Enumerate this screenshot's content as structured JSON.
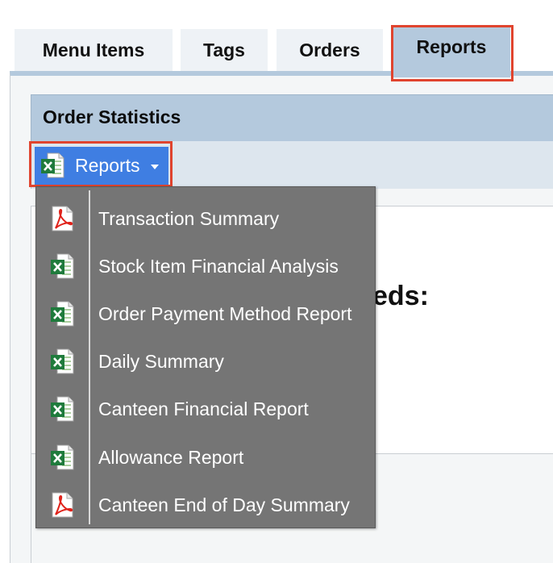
{
  "tabs": [
    {
      "label": "Menu Items"
    },
    {
      "label": "Tags"
    },
    {
      "label": "Orders"
    },
    {
      "label": "Reports",
      "active": true
    }
  ],
  "panel": {
    "title": "Order Statistics",
    "partial_text": "eds:"
  },
  "reports_button": {
    "label": "Reports",
    "icon": "excel-icon"
  },
  "reports_menu": {
    "items": [
      {
        "label": "Transaction Summary",
        "icon": "pdf-icon"
      },
      {
        "label": "Stock Item Financial Analysis",
        "icon": "excel-icon"
      },
      {
        "label": "Order Payment Method Report",
        "icon": "excel-icon"
      },
      {
        "label": "Daily Summary",
        "icon": "excel-icon"
      },
      {
        "label": "Canteen Financial Report",
        "icon": "excel-icon"
      },
      {
        "label": "Allowance Report",
        "icon": "excel-icon"
      },
      {
        "label": "Canteen End of Day Summary",
        "icon": "pdf-icon"
      }
    ]
  },
  "colors": {
    "tab_active": "#b4c9dd",
    "tab_inactive": "#eef2f6",
    "button_accent": "#3f7ee2",
    "menu_background": "#757575",
    "highlight": "#e0442e"
  }
}
